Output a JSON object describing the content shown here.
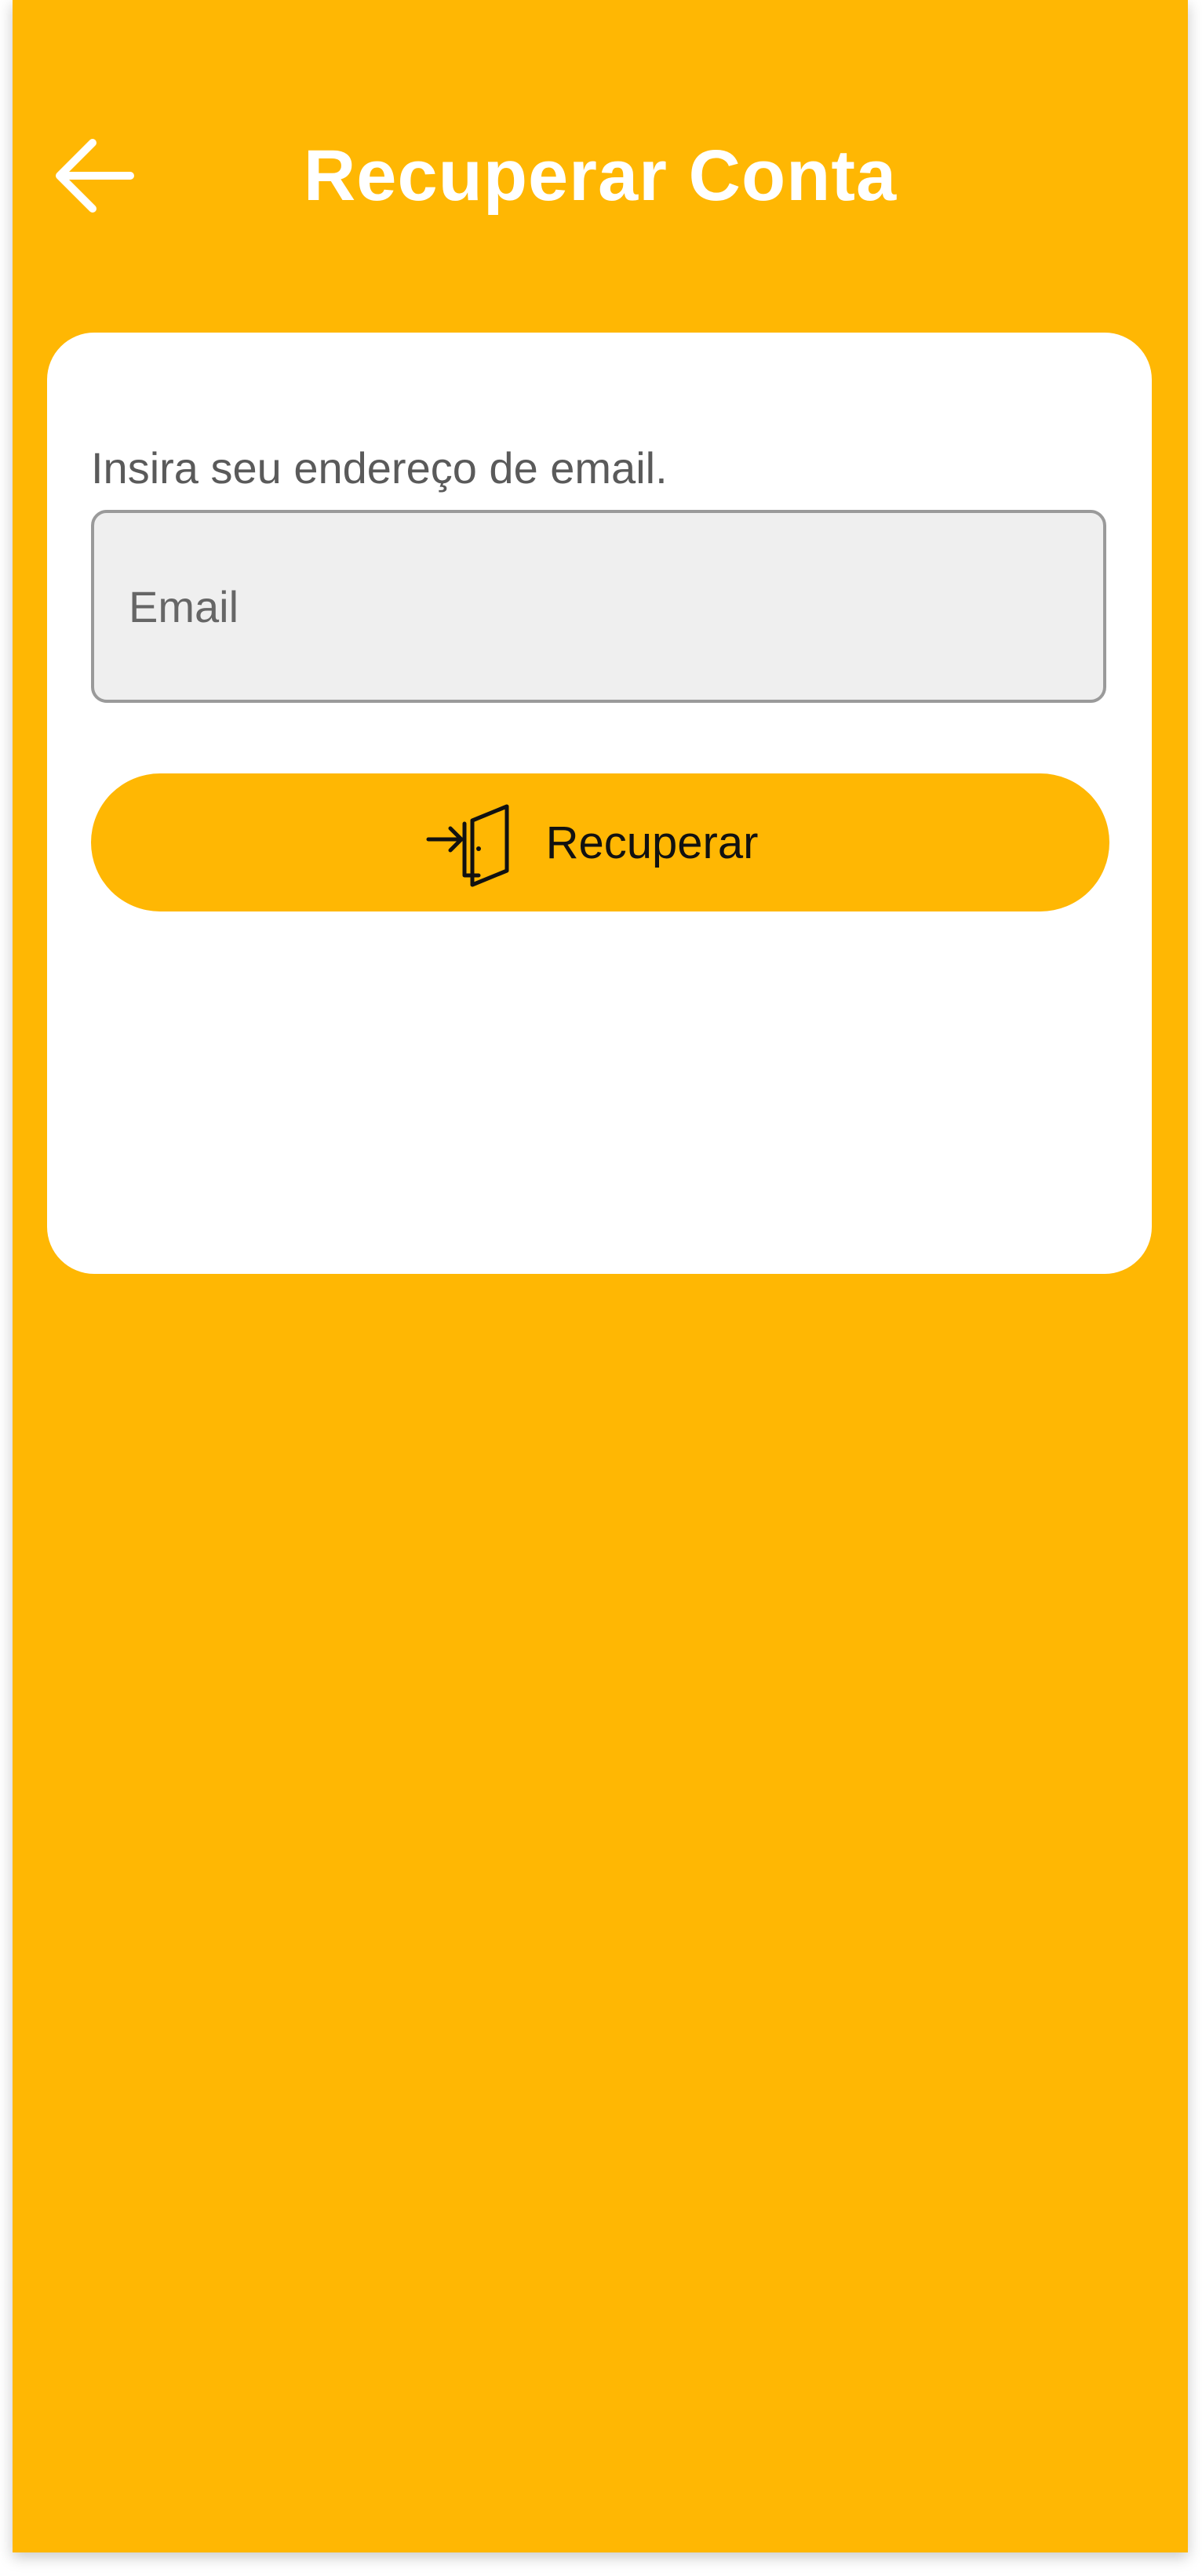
{
  "header": {
    "title": "Recuperar Conta",
    "back_icon": "arrow-left-icon"
  },
  "form": {
    "instruction": "Insira seu endereço de email.",
    "email_placeholder": "Email",
    "email_value": "",
    "submit_label": "Recuperar",
    "submit_icon": "door-enter-icon"
  },
  "colors": {
    "primary": "#FFB703",
    "card": "#FFFFFF",
    "input_bg": "#EFEFEF"
  }
}
